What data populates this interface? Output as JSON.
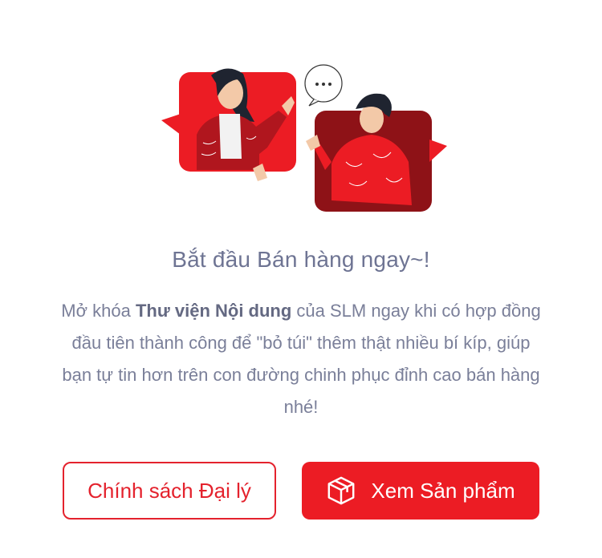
{
  "illustration": {
    "name": "two-people-chatting-illustration",
    "bubble_text": "..."
  },
  "title": "Bắt đầu Bán hàng ngay~!",
  "description": {
    "part1": "Mở khóa ",
    "bold": "Thư viện Nội dung",
    "part2": " của SLM ngay khi có hợp đồng đầu tiên thành công để \"bỏ túi\" thêm thật nhiều bí kíp, giúp bạn tự tin hơn trên con đường chinh phục đỉnh cao bán hàng nhé!"
  },
  "buttons": {
    "policy_label": "Chính sách Đại lý",
    "products_label": "Xem Sản phẩm",
    "products_icon": "box-icon"
  },
  "colors": {
    "accent": "#ec1c24",
    "dark_red": "#8e1217",
    "title": "#6e7493",
    "text": "#7a7f99"
  }
}
